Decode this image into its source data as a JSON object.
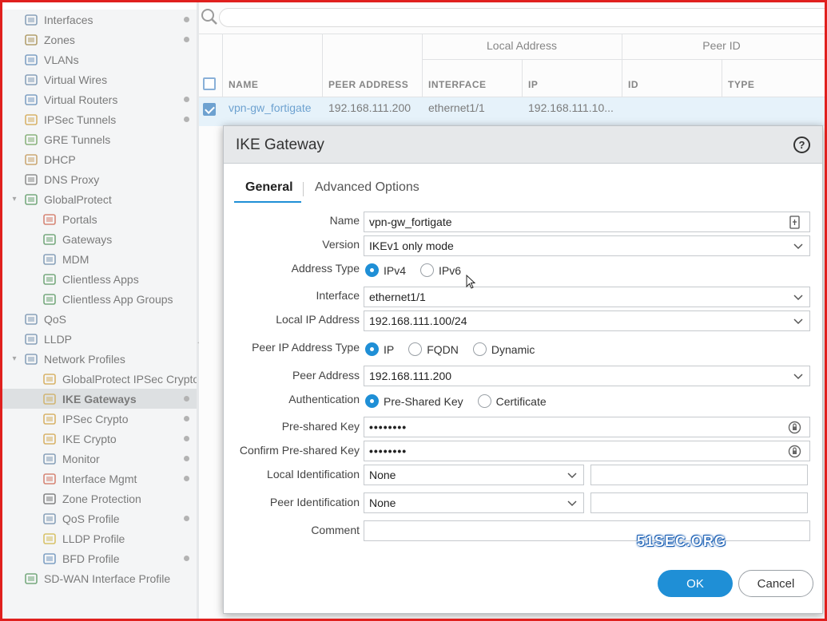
{
  "sidebar": {
    "items": [
      {
        "label": "Interfaces",
        "icon": "interfaces-icon",
        "dot": true
      },
      {
        "label": "Zones",
        "icon": "zones-icon",
        "dot": true
      },
      {
        "label": "VLANs",
        "icon": "vlans-icon",
        "dot": false
      },
      {
        "label": "Virtual Wires",
        "icon": "virtual-wires-icon",
        "dot": false
      },
      {
        "label": "Virtual Routers",
        "icon": "virtual-routers-icon",
        "dot": true
      },
      {
        "label": "IPSec Tunnels",
        "icon": "ipsec-tunnels-icon",
        "dot": true
      },
      {
        "label": "GRE Tunnels",
        "icon": "gre-tunnels-icon",
        "dot": false
      },
      {
        "label": "DHCP",
        "icon": "dhcp-icon",
        "dot": false
      },
      {
        "label": "DNS Proxy",
        "icon": "dns-proxy-icon",
        "dot": false
      },
      {
        "label": "GlobalProtect",
        "icon": "globalprotect-icon",
        "dot": false
      },
      {
        "label": "Portals",
        "icon": "portals-icon",
        "dot": false
      },
      {
        "label": "Gateways",
        "icon": "gateways-icon",
        "dot": false
      },
      {
        "label": "MDM",
        "icon": "mdm-icon",
        "dot": false
      },
      {
        "label": "Clientless Apps",
        "icon": "clientless-apps-icon",
        "dot": false
      },
      {
        "label": "Clientless App Groups",
        "icon": "clientless-app-groups-icon",
        "dot": false
      },
      {
        "label": "QoS",
        "icon": "qos-icon",
        "dot": false
      },
      {
        "label": "LLDP",
        "icon": "lldp-icon",
        "dot": false
      },
      {
        "label": "Network Profiles",
        "icon": "network-profiles-icon",
        "dot": false
      },
      {
        "label": "GlobalProtect IPSec Crypto",
        "icon": "gp-ipsec-crypto-icon",
        "dot": false
      },
      {
        "label": "IKE Gateways",
        "icon": "ike-gateways-icon",
        "dot": true
      },
      {
        "label": "IPSec Crypto",
        "icon": "ipsec-crypto-icon",
        "dot": true
      },
      {
        "label": "IKE Crypto",
        "icon": "ike-crypto-icon",
        "dot": true
      },
      {
        "label": "Monitor",
        "icon": "monitor-icon",
        "dot": true
      },
      {
        "label": "Interface Mgmt",
        "icon": "interface-mgmt-icon",
        "dot": true
      },
      {
        "label": "Zone Protection",
        "icon": "zone-protection-icon",
        "dot": false
      },
      {
        "label": "QoS Profile",
        "icon": "qos-profile-icon",
        "dot": true
      },
      {
        "label": "LLDP Profile",
        "icon": "lldp-profile-icon",
        "dot": false
      },
      {
        "label": "BFD Profile",
        "icon": "bfd-profile-icon",
        "dot": true
      },
      {
        "label": "SD-WAN Interface Profile",
        "icon": "sdwan-interface-profile-icon",
        "dot": false
      }
    ],
    "selected": "IKE Gateways"
  },
  "grid": {
    "group_headers": {
      "local_address": "Local Address",
      "peer_id": "Peer ID"
    },
    "columns": {
      "name": "NAME",
      "peer_address": "PEER ADDRESS",
      "interface": "INTERFACE",
      "ip": "IP",
      "id": "ID",
      "type": "TYPE"
    },
    "rows": [
      {
        "name": "vpn-gw_fortigate",
        "peer_address": "192.168.111.200",
        "interface": "ethernet1/1",
        "ip": "192.168.111.10..."
      }
    ]
  },
  "modal": {
    "title": "IKE Gateway",
    "tabs": {
      "general": "General",
      "advanced": "Advanced Options"
    },
    "labels": {
      "name": "Name",
      "version": "Version",
      "address_type": "Address Type",
      "interface": "Interface",
      "local_ip": "Local IP Address",
      "peer_ip_type": "Peer IP Address Type",
      "peer_address": "Peer Address",
      "authentication": "Authentication",
      "psk": "Pre-shared Key",
      "confirm_psk": "Confirm Pre-shared Key",
      "local_id": "Local Identification",
      "peer_id": "Peer Identification",
      "comment": "Comment"
    },
    "values": {
      "name": "vpn-gw_fortigate",
      "version": "IKEv1 only mode",
      "interface": "ethernet1/1",
      "local_ip": "192.168.111.100/24",
      "peer_address": "192.168.111.200",
      "psk": "••••••••",
      "confirm_psk": "••••••••",
      "local_id": "None",
      "peer_id": "None",
      "local_id_value": "",
      "peer_id_value": "",
      "comment": ""
    },
    "radios": {
      "ipv4": "IPv4",
      "ipv6": "IPv6",
      "ip": "IP",
      "fqdn": "FQDN",
      "dynamic": "Dynamic",
      "psk": "Pre-Shared Key",
      "certificate": "Certificate"
    },
    "buttons": {
      "ok": "OK",
      "cancel": "Cancel"
    }
  },
  "watermark": "51SEC.ORG",
  "colors": {
    "accent": "#1f8fd6",
    "frame": "#e0201e",
    "selection": "#d9ecf7"
  }
}
